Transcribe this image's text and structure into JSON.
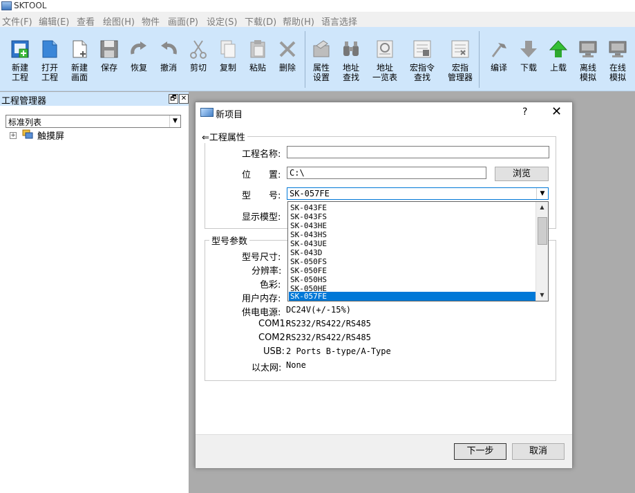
{
  "app": {
    "title": "SKTOOL"
  },
  "menu": [
    {
      "label": "文件(F)"
    },
    {
      "label": "编辑(E)"
    },
    {
      "label": "查看"
    },
    {
      "label": "绘图(H)"
    },
    {
      "label": "物件"
    },
    {
      "label": "画面(P)"
    },
    {
      "label": "设定(S)"
    },
    {
      "label": "下载(D)"
    },
    {
      "label": "帮助(H)"
    },
    {
      "label": "语言选择"
    }
  ],
  "toolbar": {
    "new_project": "新建\n工程",
    "open_project": "打开\n工程",
    "new_screen": "新建\n画面",
    "save": "保存",
    "redo": "恢复",
    "undo": "撤消",
    "cut": "剪切",
    "copy": "复制",
    "paste": "粘贴",
    "delete": "删除",
    "property_setting": "属性\n设置",
    "address_find": "地址\n查找",
    "address_list": "地址\n一览表",
    "macro_find": "宏指令\n查找",
    "macro_manager": "宏指\n管理器",
    "compile": "编译",
    "download": "下载",
    "upload": "上载",
    "offline_sim": "离线\n模拟",
    "online_sim": "在线\n模拟"
  },
  "left_panel": {
    "title": "工程管理器",
    "pin_glyph": "🗗",
    "close_glyph": "✕",
    "list_type": "标准列表",
    "tree_root": "触摸屏",
    "tree_expand": "+"
  },
  "dialog": {
    "title": "新项目",
    "help": "?",
    "close": "✕",
    "project_props_group": "工程属性",
    "back_arrow": "⇐",
    "project_name_label": "工程名称:",
    "project_name_value": "",
    "location_label": "位　　置:",
    "location_value": "C:\\",
    "browse_button": "浏览",
    "model_label": "型　　号:",
    "model_value": "SK-057FE",
    "display_model_label": "显示模型:",
    "model_params_group": "型号参数",
    "params": {
      "size_label": "型号尺寸:",
      "resolution_label": "分辨率:",
      "color_label": "色彩:",
      "memory_label": "用户内存:",
      "power_label": "供电电源:",
      "power_value": "DC24V(+/-15%)",
      "com1_label": "COM1:",
      "com1_value": "RS232/RS422/RS485",
      "com2_label": "COM2:",
      "com2_value": "RS232/RS422/RS485",
      "usb_label": "USB:",
      "usb_value": "2 Ports B-type/A-Type",
      "ethernet_label": "以太网:",
      "ethernet_value": "None"
    },
    "model_options": [
      "SK-043FE",
      "SK-043FS",
      "SK-043HE",
      "SK-043HS",
      "SK-043UE",
      "SK-043D",
      "SK-050FS",
      "SK-050FE",
      "SK-050HS",
      "SK-050HE",
      "SK-057FE"
    ],
    "selected_index": 10,
    "next_button": "下一步",
    "cancel_button": "取消"
  },
  "colors": {
    "toolbar_bg": "#cfe6fb",
    "selection": "#0078d7",
    "workspace": "#ababab"
  }
}
